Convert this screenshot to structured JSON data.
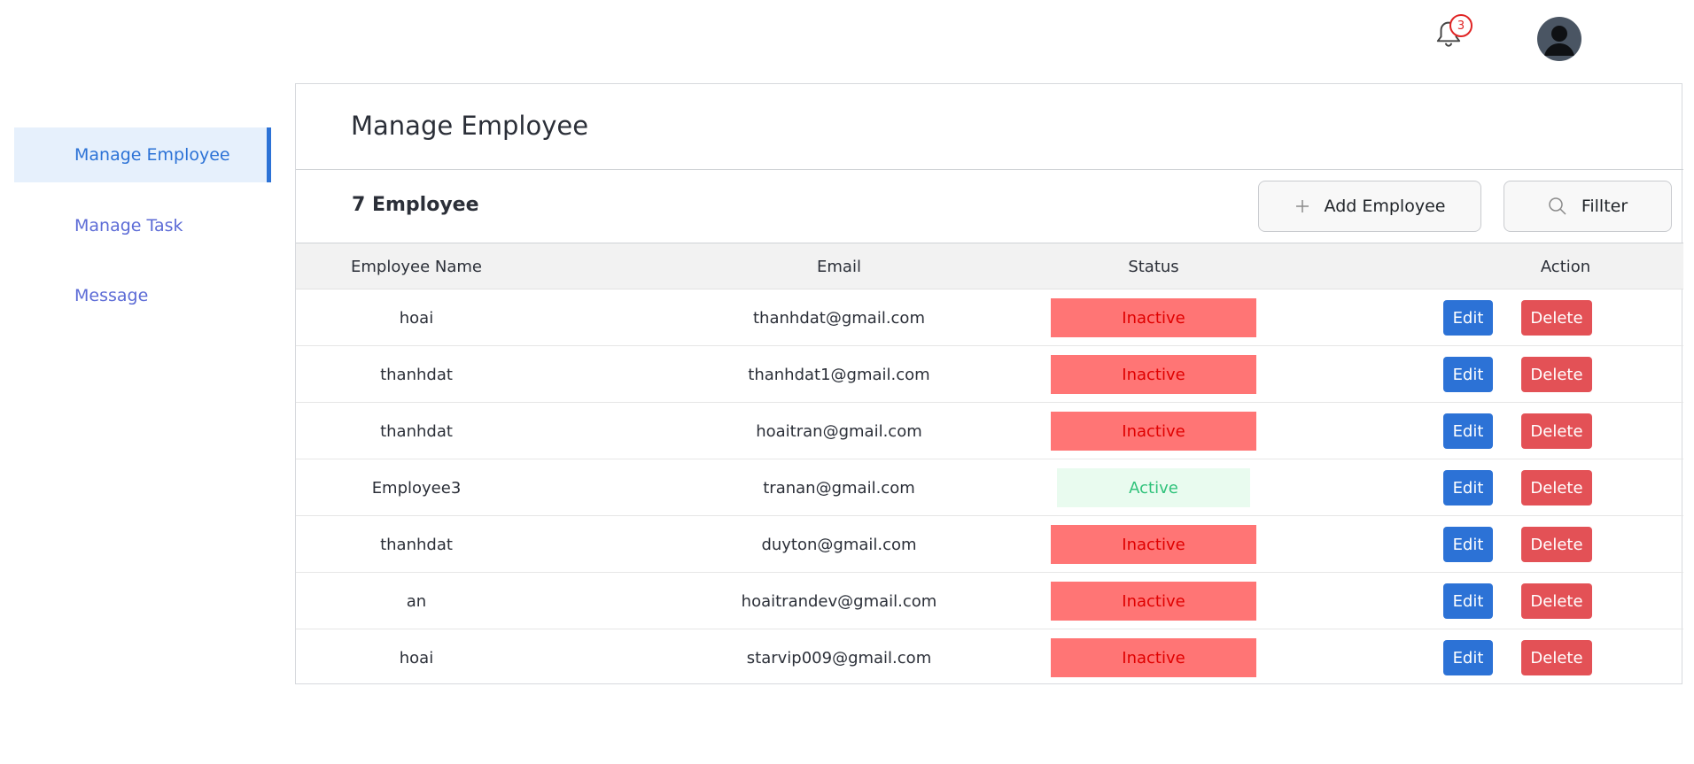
{
  "header": {
    "notification_count": "3",
    "icons": {
      "bell": "bell-icon",
      "avatar": "user-avatar-icon"
    }
  },
  "sidebar": {
    "items": [
      {
        "label": "Manage Employee",
        "active": true
      },
      {
        "label": "Manage Task",
        "active": false
      },
      {
        "label": "Message",
        "active": false
      }
    ]
  },
  "main": {
    "title": "Manage Employee",
    "count_label": "7 Employee",
    "add_button": {
      "label": "Add Employee",
      "icon": "plus-icon"
    },
    "filter_button": {
      "label": "Fillter",
      "icon": "search-icon"
    },
    "table": {
      "columns": [
        "Employee Name",
        "Email",
        "Status",
        "Action"
      ],
      "action_labels": {
        "edit": "Edit",
        "delete": "Delete"
      },
      "rows": [
        {
          "name": "hoai",
          "email": "thanhdat@gmail.com",
          "status": "Inactive"
        },
        {
          "name": "thanhdat",
          "email": "thanhdat1@gmail.com",
          "status": "Inactive"
        },
        {
          "name": "thanhdat",
          "email": "hoaitran@gmail.com",
          "status": "Inactive"
        },
        {
          "name": "Employee3",
          "email": "tranan@gmail.com",
          "status": "Active"
        },
        {
          "name": "thanhdat",
          "email": "duyton@gmail.com",
          "status": "Inactive"
        },
        {
          "name": "an",
          "email": "hoaitrandev@gmail.com",
          "status": "Inactive"
        },
        {
          "name": "hoai",
          "email": "starvip009@gmail.com",
          "status": "Inactive"
        }
      ]
    }
  },
  "colors": {
    "accent": "#2c72d6",
    "sidebar_link": "#5c6bd6",
    "inactive_bg": "#ff7575",
    "inactive_text": "#e00000",
    "active_bg": "#e9fbef",
    "active_text": "#2fc27a",
    "delete_bg": "#e35156"
  }
}
